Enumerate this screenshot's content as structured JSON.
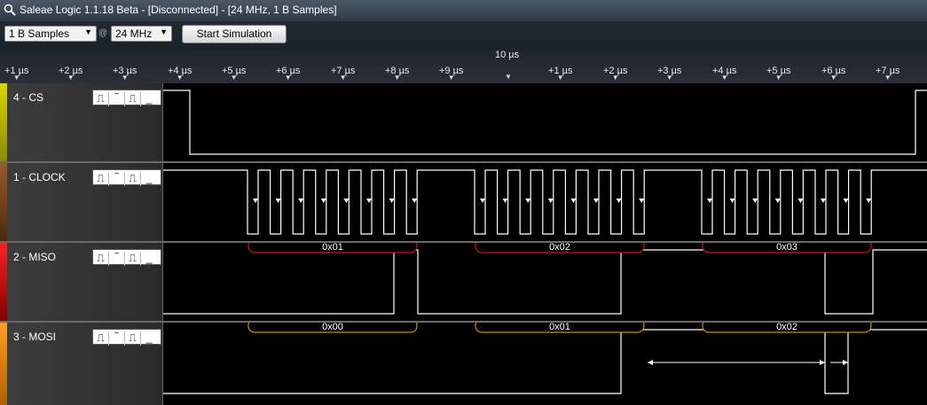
{
  "window": {
    "title": "Saleae Logic 1.1.18 Beta - [Disconnected] - [24 MHz, 1 B Samples]"
  },
  "toolbar": {
    "samples_value": "1 B Samples",
    "at_symbol": "@",
    "rate_value": "24 MHz",
    "start_label": "Start Simulation"
  },
  "ruler": {
    "center_label": "10 µs",
    "ticks": [
      "+1 µs",
      "+2 µs",
      "+3 µs",
      "+4 µs",
      "+5 µs",
      "+6 µs",
      "+7 µs",
      "+8 µs",
      "+9 µs",
      "+1 µs",
      "+2 µs",
      "+3 µs",
      "+4 µs",
      "+5 µs",
      "+6 µs",
      "+7 µs"
    ]
  },
  "channels": [
    {
      "label": "4 - CS",
      "color": "#d8d800",
      "trigger_icons": [
        "rising-edge",
        "high",
        "falling-edge",
        "low"
      ]
    },
    {
      "label": "1 - CLOCK",
      "color": "#7a4a1e",
      "trigger_icons": [
        "rising-edge",
        "high",
        "falling-edge",
        "low"
      ]
    },
    {
      "label": "2 - MISO",
      "color": "#d01010",
      "trigger_icons": [
        "rising-edge",
        "high",
        "falling-edge",
        "low"
      ],
      "decoded": [
        "0x01",
        "0x02",
        "0x03"
      ],
      "bubble_color": "#d01010"
    },
    {
      "label": "3 - MOSI",
      "color": "#e08a00",
      "trigger_icons": [
        "rising-edge",
        "high",
        "falling-edge",
        "low"
      ],
      "decoded": [
        "0x00",
        "0x01",
        "0x02"
      ],
      "bubble_color": "#d07a00"
    }
  ]
}
